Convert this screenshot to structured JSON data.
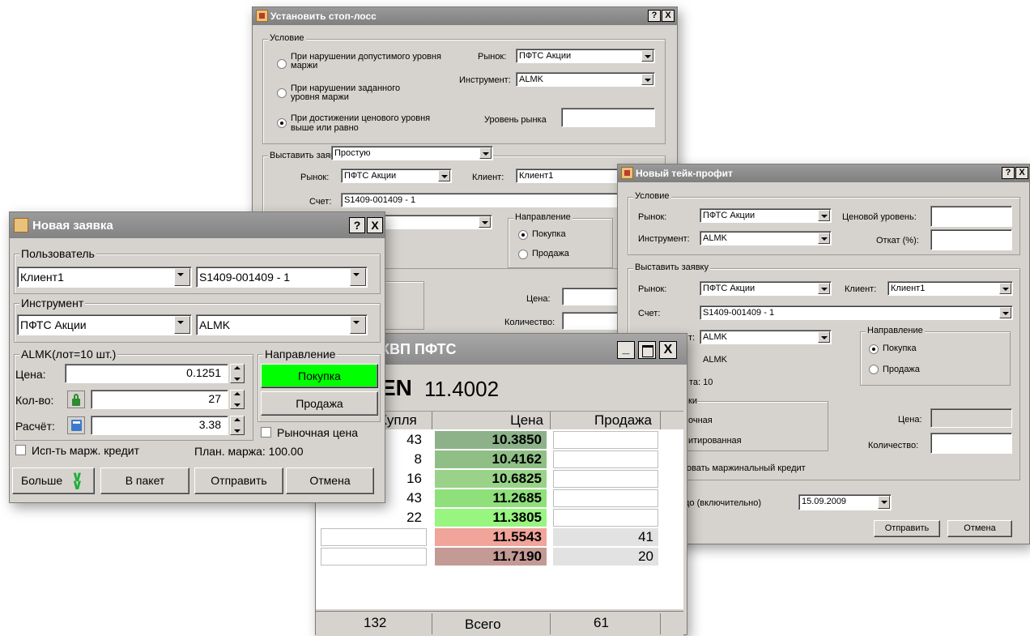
{
  "stoploss": {
    "title": "Установить стоп-лосс",
    "help": "?",
    "close": "X",
    "condition_group": "Условие",
    "radio1": "При нарушении допустимого уровня маржи",
    "radio2": "При нарушении заданного уровня маржи",
    "radio3": "При достижении ценового уровня выше или равно",
    "market_label": "Рынок:",
    "market_value": "ПФТС Акции",
    "instrument_label": "Инструмент:",
    "instrument_value": "ALMK",
    "market_level_label": "Уровень рынка",
    "place_order_label": "Выставить заявку",
    "order_type_value": "Простую",
    "market2_label": "Рынок:",
    "market2_value": "ПФТС Акции",
    "client_label": "Клиент:",
    "client_value": "Клиент1",
    "account_label": "Счет:",
    "account_value": "S1409-001409  -  1",
    "direction_group": "Направление",
    "buy": "Покупка",
    "sell": "Продажа",
    "price_label": "Цена:",
    "qty_label": "Количество:"
  },
  "takeprofit": {
    "title": "Новый тейк-профит",
    "help": "?",
    "close": "X",
    "condition_group": "Условие",
    "market_label": "Рынок:",
    "market_value": "ПФТС Акции",
    "instrument_label": "Инструмент:",
    "instrument_value": "ALMK",
    "price_level_label": "Ценовой уровень:",
    "rollback_label": "Откат (%):",
    "place_group": "Выставить заявку",
    "market2_label": "Рынок:",
    "market2_value": "ПФТС Акции",
    "client_label": "Клиент:",
    "client_value": "Клиент1",
    "account_label": "Счет:",
    "account_value": "S1409-001409  -  1",
    "instr2_label_partial": "т:",
    "instr2_value": "ALMK",
    "instr2_text": "ALMK",
    "lot_partial": "та: 10",
    "direction_group": "Направление",
    "buy": "Покупка",
    "sell": "Продажа",
    "type_group_partial": "ки",
    "type1_partial": "очная",
    "type2_partial": "итированная",
    "price_label": "Цена:",
    "qty_label": "Количество:",
    "margin_partial": "зовать маржинальный кредит",
    "valid_partial": "до (включительно)",
    "date_value": "15.09.2009",
    "send": "Отправить",
    "cancel": "Отмена"
  },
  "quotes": {
    "title": "КВП ПФТС",
    "ticker_partial": "EN",
    "last_price": "11.4002",
    "col_buy": "Купля",
    "col_price": "Цена",
    "col_sell": "Продажа",
    "rows": [
      {
        "buy": "43",
        "price": "10.3850",
        "sell": "",
        "color": "#8db28a"
      },
      {
        "buy": "8",
        "price": "10.4162",
        "sell": "",
        "color": "#8fbf85"
      },
      {
        "buy": "16",
        "price": "10.6825",
        "sell": "",
        "color": "#99d288"
      },
      {
        "buy": "43",
        "price": "11.2685",
        "sell": "",
        "color": "#8fe07a"
      },
      {
        "buy": "22",
        "price": "11.3805",
        "sell": "",
        "color": "#98f580"
      },
      {
        "buy": "",
        "price": "11.5543",
        "sell": "41",
        "color": "#f0a49a"
      },
      {
        "buy": "",
        "price": "11.7190",
        "sell": "20",
        "color": "#c49a95"
      }
    ],
    "total_buy": "132",
    "total_label": "Всего",
    "total_sell": "61"
  },
  "order": {
    "title": "Новая заявка",
    "help": "?",
    "close": "X",
    "user_group": "Пользователь",
    "client_value": "Клиент1",
    "account_value": "S1409-001409  -  1",
    "instr_group": "Инструмент",
    "market_value": "ПФТС Акции",
    "instr_value": "ALMK",
    "lot_group": "ALMK(лот=10 шт.)",
    "price_label": "Цена:",
    "price_value": "0.1251",
    "qty_label": "Кол-во:",
    "qty_value": "27",
    "calc_label": "Расчёт:",
    "calc_value": "3.38",
    "direction_group": "Направление",
    "buy": "Покупка",
    "sell": "Продажа",
    "market_price": "Рыночная цена",
    "margin_credit": "Исп-ть марж. кредит",
    "plan_margin": "План. маржа: 100.00",
    "more": "Больше",
    "to_package": "В пакет",
    "send": "Отправить",
    "cancel": "Отмена"
  }
}
